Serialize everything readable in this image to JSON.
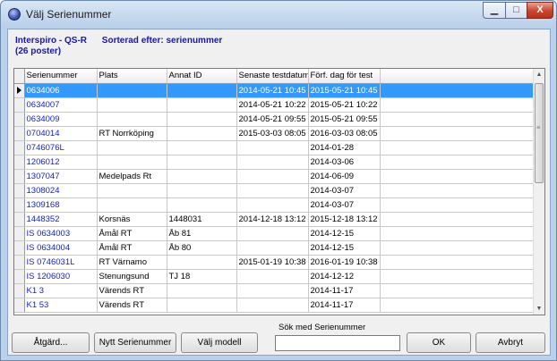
{
  "window": {
    "title": "Välj Serienummer",
    "min_glyph": "▁",
    "max_glyph": "□",
    "close_glyph": "X"
  },
  "header": {
    "company": "Interspiro - QS-R",
    "sorted_by": "Sorterad efter: serienummer",
    "count": "(26 poster)"
  },
  "grid": {
    "columns": [
      "Serienummer",
      "Plats",
      "Annat ID",
      "Senaste testdatum",
      "Förf. dag för test"
    ],
    "rows": [
      [
        "0634006",
        "",
        "",
        "2014-05-21 10:45",
        "2015-05-21 10:45"
      ],
      [
        "0634007",
        "",
        "",
        "2014-05-21 10:22",
        "2015-05-21 10:22"
      ],
      [
        "0634009",
        "",
        "",
        "2014-05-21 09:55",
        "2015-05-21 09:55"
      ],
      [
        "0704014",
        "RT Norrköping",
        "",
        "2015-03-03 08:05",
        "2016-03-03 08:05"
      ],
      [
        "0746076L",
        "",
        "",
        "",
        "2014-01-28"
      ],
      [
        "1206012",
        "",
        "",
        "",
        "2014-03-06"
      ],
      [
        "1307047",
        "Medelpads Rt",
        "",
        "",
        "2014-06-09"
      ],
      [
        "1308024",
        "",
        "",
        "",
        "2014-03-07"
      ],
      [
        "1309168",
        "",
        "",
        "",
        "2014-03-07"
      ],
      [
        "1448352",
        "Korsnäs",
        "1448031",
        "2014-12-18 13:12",
        "2015-12-18 13:12"
      ],
      [
        "IS 0634003",
        "Åmål RT",
        "Åb 81",
        "",
        "2014-12-15"
      ],
      [
        "IS 0634004",
        "Åmål RT",
        "Åb 80",
        "",
        "2014-12-15"
      ],
      [
        "IS 0746031L",
        "RT Värnamo",
        "",
        "2015-01-19 10:38",
        "2016-01-19 10:38"
      ],
      [
        "IS 1206030",
        "Stenungsund",
        "TJ 18",
        "",
        "2014-12-12"
      ],
      [
        "K1 3",
        "Värends RT",
        "",
        "",
        "2014-11-17"
      ],
      [
        "K1 53",
        "Värends RT",
        "",
        "",
        "2014-11-17"
      ]
    ],
    "selected_row": 0,
    "scroll_up": "▲",
    "scroll_down": "▼",
    "scroll_grip": "≡"
  },
  "search": {
    "label": "Sök med Serienummer",
    "value": "",
    "placeholder": ""
  },
  "buttons": {
    "atgard": "Åtgärd...",
    "nytt": "Nytt Serienummer",
    "valj": "Välj modell",
    "ok": "OK",
    "avbryt": "Avbryt"
  },
  "colors": {
    "selection": "#3399ff",
    "serial_text": "#1a22c8",
    "header_text": "#1515b8"
  }
}
